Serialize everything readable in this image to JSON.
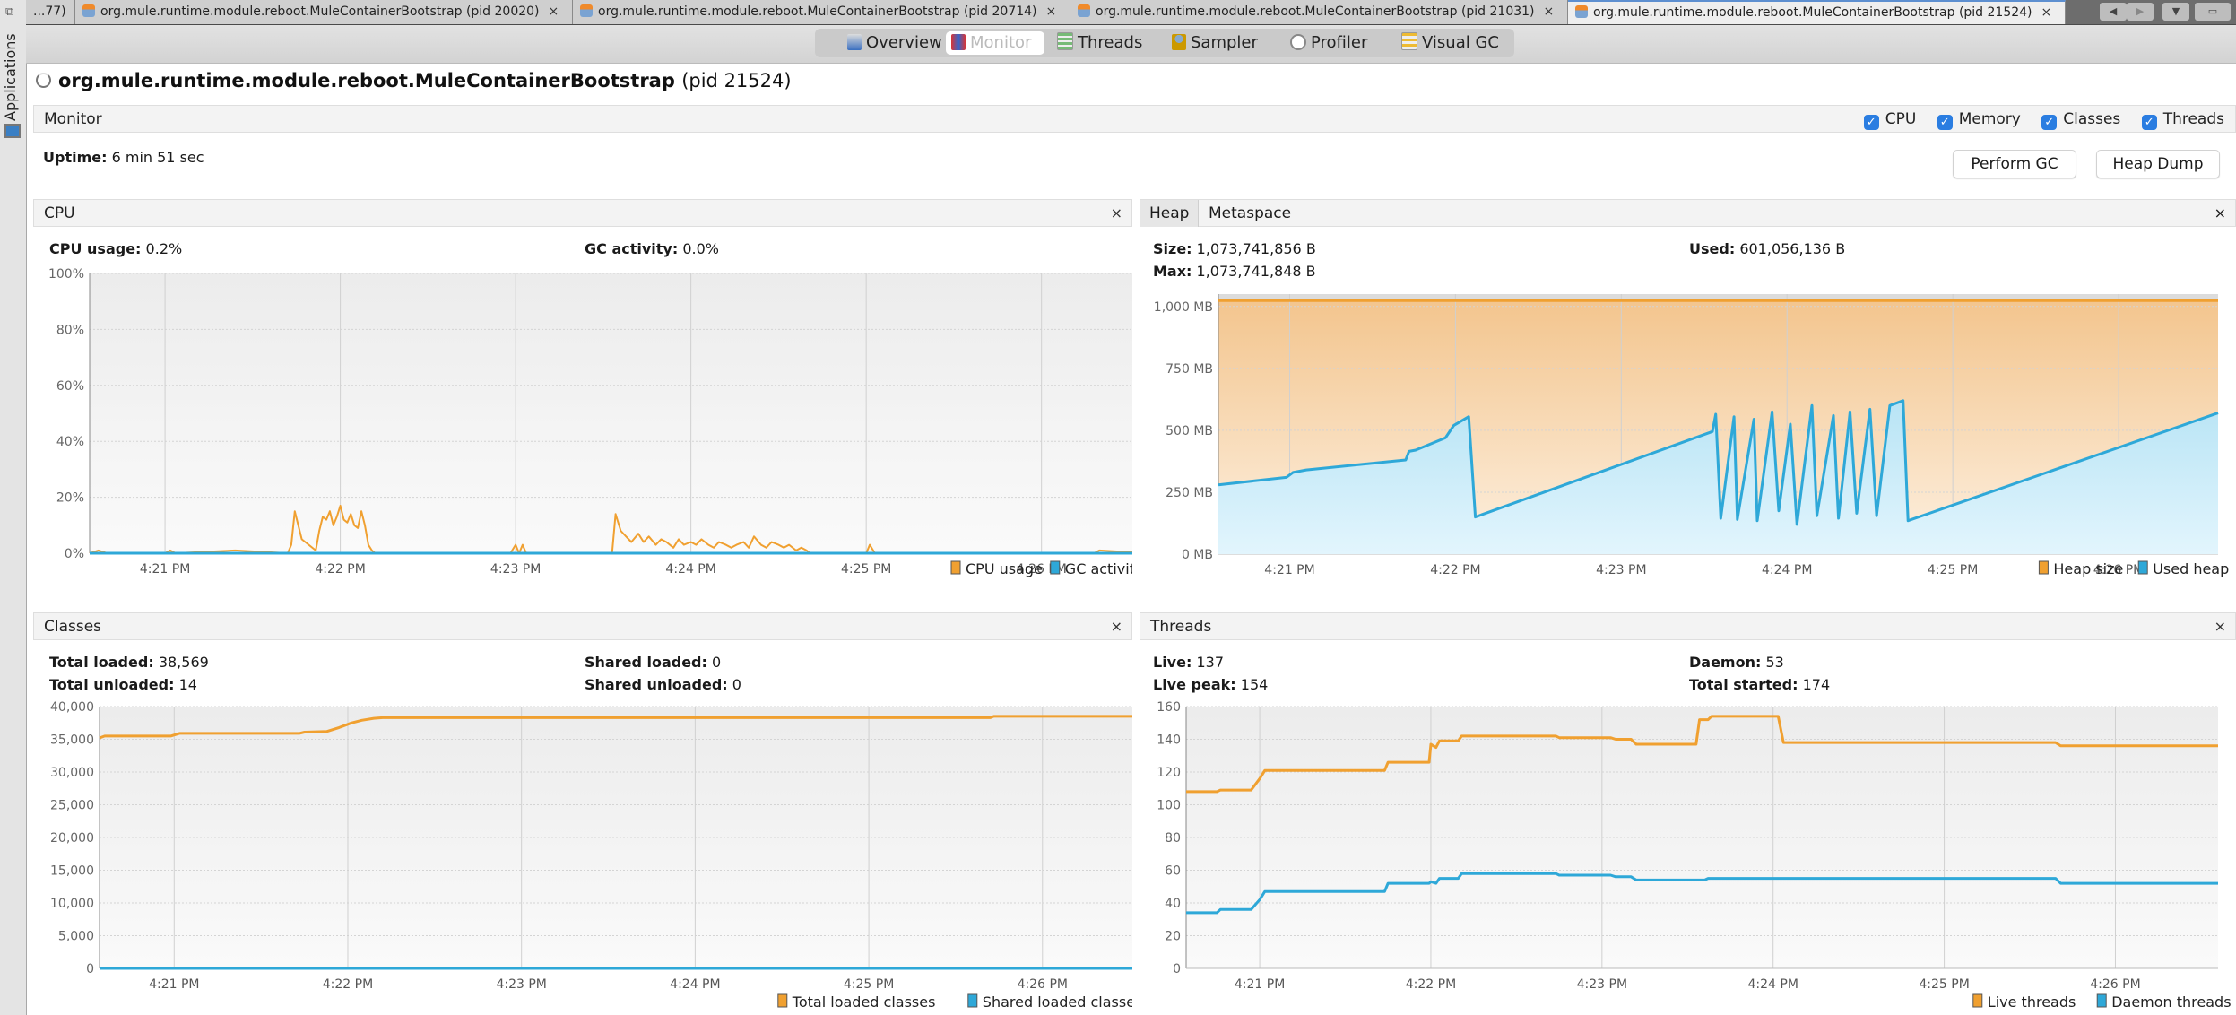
{
  "sidebar": {
    "label": "Applications",
    "dock_icon": "restore-window-icon",
    "app_icon": "computer-icon"
  },
  "tabs": [
    {
      "label": "...77)",
      "closable": false
    },
    {
      "label": "org.mule.runtime.module.reboot.MuleContainerBootstrap (pid 20020)",
      "close": "×"
    },
    {
      "label": "org.mule.runtime.module.reboot.MuleContainerBootstrap (pid 20714)",
      "close": "×"
    },
    {
      "label": "org.mule.runtime.module.reboot.MuleContainerBootstrap (pid 21031)",
      "close": "×"
    },
    {
      "label": "org.mule.runtime.module.reboot.MuleContainerBootstrap (pid 21524)",
      "close": "×",
      "active": true
    }
  ],
  "nav": {
    "prev": "◀",
    "next": "▶",
    "menu": "▼",
    "window": "▭"
  },
  "toolbar": {
    "items": [
      {
        "label": "Overview"
      },
      {
        "label": "Monitor",
        "selected": true
      },
      {
        "label": "Threads"
      },
      {
        "label": "Sampler"
      },
      {
        "label": "Profiler"
      },
      {
        "label": "Visual GC"
      }
    ]
  },
  "page": {
    "title": "org.mule.runtime.module.reboot.MuleContainerBootstrap",
    "pid": "(pid 21524)"
  },
  "monitor": {
    "header": "Monitor",
    "checks": [
      {
        "label": "CPU",
        "checked": true
      },
      {
        "label": "Memory",
        "checked": true
      },
      {
        "label": "Classes",
        "checked": true
      },
      {
        "label": "Threads",
        "checked": true
      }
    ],
    "uptime_label": "Uptime:",
    "uptime_value": "6 min 51 sec",
    "perform_gc": "Perform GC",
    "heap_dump": "Heap Dump"
  },
  "cpu": {
    "header": "CPU",
    "close": "×",
    "usage_label": "CPU usage:",
    "usage_value": "0.2%",
    "gc_label": "GC activity:",
    "gc_value": "0.0%",
    "legend": [
      "CPU usage",
      "GC activity"
    ]
  },
  "heap": {
    "tabs": [
      "Heap",
      "Metaspace"
    ],
    "close": "×",
    "size_label": "Size:",
    "size_value": "1,073,741,856 B",
    "max_label": "Max:",
    "max_value": "1,073,741,848 B",
    "used_label": "Used:",
    "used_value": "601,056,136 B",
    "legend": [
      "Heap size",
      "Used heap"
    ]
  },
  "classes": {
    "header": "Classes",
    "close": "×",
    "total_loaded_label": "Total loaded:",
    "total_loaded_value": "38,569",
    "total_unloaded_label": "Total unloaded:",
    "total_unloaded_value": "14",
    "shared_loaded_label": "Shared loaded:",
    "shared_loaded_value": "0",
    "shared_unloaded_label": "Shared unloaded:",
    "shared_unloaded_value": "0",
    "legend": [
      "Total loaded classes",
      "Shared loaded classes"
    ]
  },
  "threads": {
    "header": "Threads",
    "close": "×",
    "live_label": "Live:",
    "live_value": "137",
    "peak_label": "Live peak:",
    "peak_value": "154",
    "daemon_label": "Daemon:",
    "daemon_value": "53",
    "started_label": "Total started:",
    "started_value": "174",
    "legend": [
      "Live threads",
      "Daemon threads"
    ]
  },
  "colors": {
    "orange": "#f0a030",
    "blue": "#2ea8d8",
    "plot_bg": "#f2f2f2",
    "grid": "#d8d8d8"
  },
  "chart_data": [
    {
      "type": "line",
      "title": "CPU",
      "xlabel": "",
      "ylabel": "",
      "x_ticks": [
        "4:21 PM",
        "4:22 PM",
        "4:23 PM",
        "4:24 PM",
        "4:25 PM",
        "4:26 PM"
      ],
      "x_range_minutes": [
        20.57,
        26.6
      ],
      "y_ticks": [
        "0%",
        "20%",
        "40%",
        "60%",
        "80%",
        "100%"
      ],
      "ylim": [
        0,
        100
      ],
      "legend": "bottom-right",
      "series": [
        {
          "name": "CPU usage",
          "color": "#f0a030",
          "x": [
            20.57,
            20.62,
            20.67,
            20.7,
            21.0,
            21.03,
            21.06,
            21.4,
            21.7,
            21.72,
            21.74,
            21.78,
            21.82,
            21.86,
            21.88,
            21.9,
            21.92,
            21.94,
            21.96,
            21.98,
            22.0,
            22.02,
            22.04,
            22.06,
            22.08,
            22.1,
            22.12,
            22.14,
            22.16,
            22.18,
            22.2,
            22.25,
            22.5,
            22.97,
            23.0,
            23.02,
            23.04,
            23.06,
            23.55,
            23.57,
            23.6,
            23.63,
            23.66,
            23.7,
            23.73,
            23.76,
            23.8,
            23.83,
            23.86,
            23.9,
            23.93,
            23.96,
            24.0,
            24.03,
            24.06,
            24.1,
            24.13,
            24.16,
            24.2,
            24.23,
            24.26,
            24.3,
            24.33,
            24.36,
            24.4,
            24.43,
            24.46,
            24.5,
            24.53,
            24.56,
            24.6,
            24.63,
            24.66,
            24.68,
            25.0,
            25.02,
            25.05,
            26.3,
            26.33,
            26.6
          ],
          "y": [
            0,
            1,
            0,
            0,
            0,
            1,
            0,
            1,
            0,
            3,
            15,
            5,
            3,
            1,
            8,
            13,
            12,
            15,
            10,
            13,
            17,
            12,
            11,
            14,
            10,
            9,
            15,
            10,
            3,
            1,
            0,
            0,
            0,
            0,
            3,
            0,
            3,
            0,
            0,
            14,
            8,
            6,
            4,
            7,
            4,
            6,
            3,
            5,
            4,
            2,
            5,
            3,
            4,
            3,
            5,
            3,
            2,
            4,
            3,
            2,
            3,
            4,
            2,
            6,
            3,
            2,
            4,
            3,
            2,
            3,
            1,
            2,
            1,
            0,
            0,
            3,
            0,
            0,
            1,
            0
          ]
        },
        {
          "name": "GC activity",
          "color": "#2ea8d8",
          "x": [
            20.57,
            26.6
          ],
          "y": [
            0,
            0
          ]
        }
      ]
    },
    {
      "type": "area",
      "title": "Heap",
      "x_ticks": [
        "4:21 PM",
        "4:22 PM",
        "4:23 PM",
        "4:24 PM",
        "4:25 PM",
        "4:26 PM"
      ],
      "x_range_minutes": [
        20.57,
        26.6
      ],
      "y_ticks": [
        "0 MB",
        "250 MB",
        "500 MB",
        "750 MB",
        "1,000 MB"
      ],
      "ylim": [
        0,
        1050
      ],
      "legend": "bottom-right",
      "series": [
        {
          "name": "Heap size",
          "color": "#f0a030",
          "x": [
            20.57,
            26.6
          ],
          "y": [
            1024,
            1024
          ]
        },
        {
          "name": "Used heap",
          "color": "#2ea8d8",
          "x": [
            20.57,
            20.98,
            21.02,
            21.1,
            21.7,
            21.72,
            21.76,
            21.94,
            21.99,
            22.08,
            22.12,
            23.55,
            23.57,
            23.6,
            23.68,
            23.7,
            23.8,
            23.82,
            23.91,
            23.95,
            24.02,
            24.06,
            24.15,
            24.18,
            24.28,
            24.31,
            24.38,
            24.42,
            24.5,
            24.54,
            24.62,
            24.7,
            24.73,
            26.6
          ],
          "y": [
            280,
            310,
            330,
            340,
            380,
            415,
            420,
            470,
            520,
            555,
            150,
            495,
            565,
            145,
            555,
            140,
            545,
            135,
            575,
            175,
            525,
            120,
            600,
            155,
            560,
            145,
            575,
            165,
            585,
            155,
            600,
            620,
            135,
            570
          ]
        }
      ]
    },
    {
      "type": "line",
      "title": "Classes",
      "x_ticks": [
        "4:21 PM",
        "4:22 PM",
        "4:23 PM",
        "4:24 PM",
        "4:25 PM",
        "4:26 PM"
      ],
      "x_range_minutes": [
        20.57,
        26.6
      ],
      "y_ticks": [
        "0",
        "5,000",
        "10,000",
        "15,000",
        "20,000",
        "25,000",
        "30,000",
        "35,000",
        "40,000"
      ],
      "ylim": [
        0,
        40000
      ],
      "legend": "bottom-right",
      "series": [
        {
          "name": "Total loaded classes",
          "color": "#f0a030",
          "x": [
            20.57,
            20.6,
            20.98,
            21.03,
            21.72,
            21.75,
            21.88,
            21.95,
            22.02,
            22.08,
            22.15,
            22.2,
            25.7,
            25.72,
            26.6
          ],
          "y": [
            35200,
            35500,
            35500,
            35900,
            35900,
            36100,
            36200,
            36800,
            37500,
            37900,
            38200,
            38300,
            38300,
            38500,
            38500
          ]
        },
        {
          "name": "Shared loaded classes",
          "color": "#2ea8d8",
          "x": [
            20.57,
            26.6
          ],
          "y": [
            0,
            0
          ]
        }
      ]
    },
    {
      "type": "line",
      "title": "Threads",
      "x_ticks": [
        "4:21 PM",
        "4:22 PM",
        "4:23 PM",
        "4:24 PM",
        "4:25 PM",
        "4:26 PM"
      ],
      "x_range_minutes": [
        20.57,
        26.6
      ],
      "y_ticks": [
        "0",
        "20",
        "40",
        "60",
        "80",
        "100",
        "120",
        "140",
        "160"
      ],
      "ylim": [
        0,
        160
      ],
      "legend": "bottom-right",
      "series": [
        {
          "name": "Live threads",
          "color": "#f0a030",
          "x": [
            20.57,
            20.75,
            20.77,
            20.95,
            21.0,
            21.03,
            21.73,
            21.75,
            21.99,
            22.0,
            22.03,
            22.05,
            22.16,
            22.18,
            22.73,
            22.75,
            23.05,
            23.08,
            23.17,
            23.2,
            23.55,
            23.57,
            23.62,
            23.64,
            24.03,
            24.06,
            25.65,
            25.68,
            26.6
          ],
          "y": [
            108,
            108,
            109,
            109,
            116,
            121,
            121,
            126,
            126,
            137,
            135,
            139,
            139,
            142,
            142,
            141,
            141,
            140,
            140,
            137,
            137,
            152,
            152,
            154,
            154,
            138,
            138,
            136,
            136
          ]
        },
        {
          "name": "Daemon threads",
          "color": "#2ea8d8",
          "x": [
            20.57,
            20.75,
            20.77,
            20.95,
            21.0,
            21.03,
            21.73,
            21.75,
            21.99,
            22.0,
            22.03,
            22.05,
            22.16,
            22.18,
            22.73,
            22.75,
            23.05,
            23.08,
            23.17,
            23.2,
            23.6,
            23.62,
            25.65,
            25.68,
            26.6
          ],
          "y": [
            34,
            34,
            36,
            36,
            42,
            47,
            47,
            52,
            52,
            53,
            52,
            55,
            55,
            58,
            58,
            57,
            57,
            56,
            56,
            54,
            54,
            55,
            55,
            52,
            52
          ]
        }
      ]
    }
  ]
}
